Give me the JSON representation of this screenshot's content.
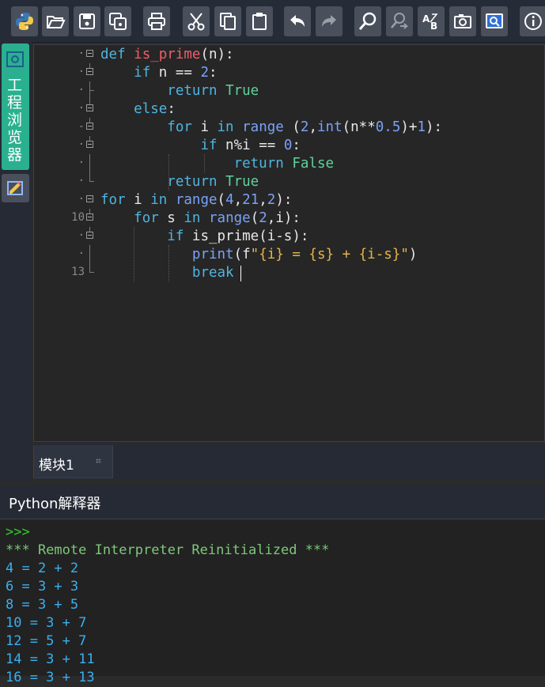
{
  "toolbar": {
    "buttons": [
      {
        "icon": "python-icon",
        "tooltip": ""
      },
      {
        "icon": "open-folder-icon"
      },
      {
        "icon": "save-icon"
      },
      {
        "icon": "save-all-icon"
      },
      {
        "icon": "print-icon"
      },
      {
        "icon": "cut-icon"
      },
      {
        "icon": "copy-icon"
      },
      {
        "icon": "paste-icon"
      },
      {
        "icon": "undo-icon"
      },
      {
        "icon": "redo-icon",
        "state": "disabled"
      },
      {
        "icon": "find-icon"
      },
      {
        "icon": "replace-icon",
        "state": "disabled"
      },
      {
        "icon": "spell-check-icon"
      },
      {
        "icon": "screenshot-icon"
      },
      {
        "icon": "preview-icon"
      },
      {
        "icon": "info-icon"
      }
    ]
  },
  "sidebar": {
    "explorer_label": "工程浏览器",
    "explorer_icon": "project-icon",
    "edit_icon": "edit-icon"
  },
  "editor": {
    "line_numbers": {
      "10": "10",
      "13": "13"
    },
    "code": [
      "def is_prime(n):",
      "    if n == 2:",
      "        return True",
      "    else:",
      "        for i in range (2,int(n**0.5)+1):",
      "            if n%i == 0:",
      "                return False",
      "        return True",
      "for i in range(4,21,2):",
      "    for s in range(2,i):",
      "        if is_prime(i-s):",
      "            print(f\"{i} = {s} + {i-s}\")",
      "            break"
    ]
  },
  "tabs": {
    "module_label": "模块1",
    "pin_icon": "pin-icon"
  },
  "interpreter": {
    "title": "Python解释器",
    "prompt": ">>>",
    "reinit_message": "*** Remote Interpreter Reinitialized ***",
    "output": [
      "4 = 2 + 2",
      "6 = 3 + 3",
      "8 = 3 + 5",
      "10 = 3 + 7",
      "12 = 5 + 7",
      "14 = 3 + 11",
      "16 = 3 + 13"
    ]
  },
  "colors": {
    "keyword": "#4fb4e0",
    "function_name": "#ef5d6c",
    "builtin": "#7aa2f7",
    "string": "#e6b44a",
    "literal": "#5fd39c",
    "prompt_green": "#32cd32",
    "output_blue": "#3ab0f0",
    "accent_teal": "#2ab08f"
  }
}
